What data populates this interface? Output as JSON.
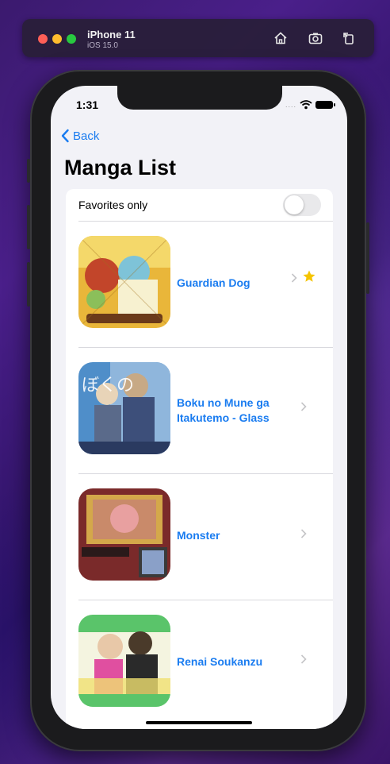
{
  "simulator": {
    "device_name": "iPhone 11",
    "os_version": "iOS 15.0",
    "icons": [
      "home-icon",
      "screenshot-icon",
      "rotate-icon"
    ]
  },
  "status_bar": {
    "time": "1:31",
    "signal": "....",
    "icons": [
      "wifi-icon",
      "battery-icon"
    ]
  },
  "nav": {
    "back_label": "Back",
    "title": "Manga List"
  },
  "filter": {
    "label": "Favorites only",
    "enabled": false
  },
  "manga": [
    {
      "title": "Guardian Dog",
      "favorite": true,
      "cover_colors": [
        "#e8c23a",
        "#7ec3d8",
        "#c2452a"
      ]
    },
    {
      "title": "Boku no Mune ga Itakutemo - Glass",
      "favorite": false,
      "cover_colors": [
        "#4f8ec9",
        "#c7a985",
        "#3d4f7a"
      ]
    },
    {
      "title": "Monster",
      "favorite": false,
      "cover_colors": [
        "#7a2a2a",
        "#c98a6a",
        "#d4a84a"
      ]
    },
    {
      "title": "Renai Soukanzu",
      "favorite": false,
      "cover_colors": [
        "#5ac46a",
        "#e04fa0",
        "#f0e070"
      ]
    }
  ],
  "colors": {
    "accent": "#1a7cf0",
    "star": "#f5c400"
  }
}
